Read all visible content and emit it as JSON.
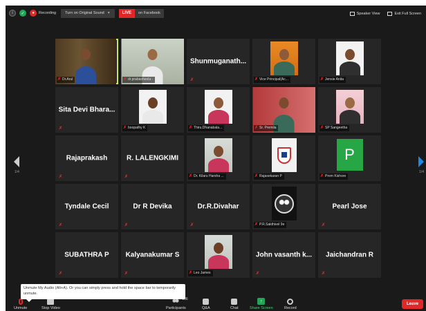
{
  "topbar": {
    "recording_label": "Recording",
    "audio_button": "Turn on Original Sound",
    "live_badge": "LIVE",
    "live_target": "on Facebook",
    "speaker_view": "Speaker View",
    "exit_fullscreen": "Exit Full Screen"
  },
  "pager": {
    "left": "1/4",
    "right": "1/4"
  },
  "tiles": [
    {
      "type": "video",
      "label": "Dr.Arul",
      "bg": "shelf",
      "active": true
    },
    {
      "type": "video",
      "label": "dr.prabasheela -",
      "bg": "wall"
    },
    {
      "type": "name",
      "name": "Shunmuganath..."
    },
    {
      "type": "video",
      "label": "Vice Principal(Ac...",
      "bg": "orange"
    },
    {
      "type": "video",
      "label": "Jensie Anita",
      "bg": "white"
    },
    {
      "type": "name",
      "name": "Sita Devi Bhara..."
    },
    {
      "type": "video",
      "label": "boopathy K",
      "bg": "white"
    },
    {
      "type": "video",
      "label": "Thiru.Dhanabala...",
      "bg": "white"
    },
    {
      "type": "video",
      "label": "Sr. Premila",
      "bg": "red"
    },
    {
      "type": "video",
      "label": "SP Sangeetha",
      "bg": "pink"
    },
    {
      "type": "name",
      "name": "Rajaprakash"
    },
    {
      "type": "name",
      "name": "R. LALENGKIMI"
    },
    {
      "type": "video",
      "label": "Dr. Kilaru Harsha ...",
      "bg": "grey"
    },
    {
      "type": "logo",
      "label": "Rajasekaran P"
    },
    {
      "type": "letter",
      "label": "Prem Kishore",
      "letter": "P"
    },
    {
      "type": "name",
      "name": "Tyndale Cecil"
    },
    {
      "type": "name",
      "name": "Dr R Devika"
    },
    {
      "type": "name",
      "name": "Dr.R.Divahar"
    },
    {
      "type": "tiger",
      "label": "P.R.Sakthivel 9e"
    },
    {
      "type": "name",
      "name": "Pearl Jose"
    },
    {
      "type": "name",
      "name": "SUBATHRA P"
    },
    {
      "type": "name",
      "name": "Kalyanakumar S"
    },
    {
      "type": "video",
      "label": "Leo James",
      "bg": "grey"
    },
    {
      "type": "name",
      "name": "John vasanth k..."
    },
    {
      "type": "name",
      "name": "Jaichandran R"
    }
  ],
  "tooltip": "Unmute My Audio (Alt+A). Or you can simply press and hold the space bar to temporarily unmute.",
  "bottombar": {
    "unmute": "Unmute",
    "stop_video": "Stop Video",
    "participants": "Participants",
    "participant_count": "106",
    "qa": "Q&A",
    "chat": "Chat",
    "share_screen": "Share Screen",
    "record": "Record",
    "leave": "Leave"
  },
  "colors": {
    "active_border": "#c8e85a",
    "live_red": "#e02828",
    "share_green": "#23a559",
    "nav_blue": "#1e88e5"
  }
}
